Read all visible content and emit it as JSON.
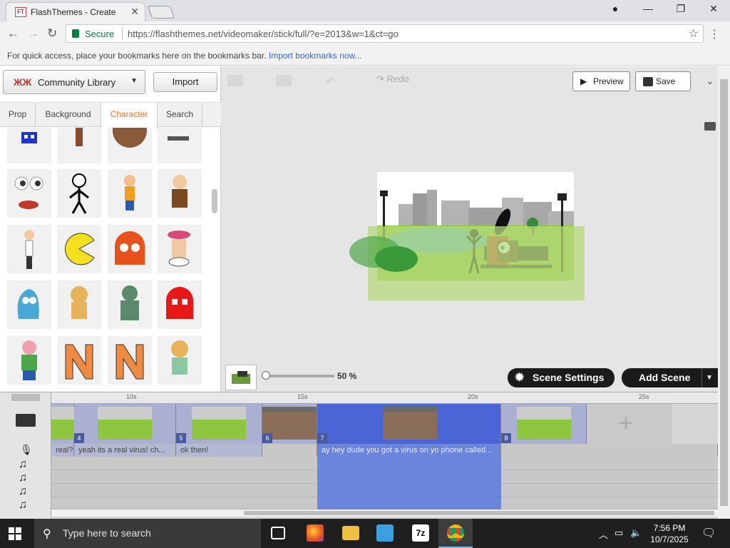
{
  "browser": {
    "tab_title": "FlashThemes - Create",
    "favicon_text": "FT",
    "secure_label": "Secure",
    "url": "https://flashthemes.net/videomaker/stick/full/?e=2013&w=1&ct=go",
    "bookmarks_message": "For quick access, place your bookmarks here on the bookmarks bar.",
    "bookmarks_link": "Import bookmarks now..."
  },
  "library": {
    "selector_label": "Community Library",
    "import_label": "Import",
    "tabs": [
      "Prop",
      "Background",
      "Character",
      "Search"
    ],
    "active_tab": "Character"
  },
  "toolbar": {
    "redo_label": "Redo",
    "preview_label": "Preview",
    "save_label": "Save"
  },
  "stage_controls": {
    "zoom_level": "50 %",
    "zoom_fraction": 0.0,
    "scene_settings_label": "Scene Settings",
    "add_scene_label": "Add Scene"
  },
  "timeline": {
    "ruler_labels": [
      "10s",
      "15s",
      "20s",
      "25s"
    ],
    "scenes": [
      {
        "number": "",
        "dialogue": "real?"
      },
      {
        "number": "4",
        "dialogue": "yeah its a real virus! ch..."
      },
      {
        "number": "5",
        "dialogue": "ok then!"
      },
      {
        "number": "6",
        "dialogue": ""
      },
      {
        "number": "7",
        "dialogue": "ay hey dude you got a virus on yo phone called..."
      },
      {
        "number": "8",
        "dialogue": ""
      }
    ]
  },
  "taskbar": {
    "search_placeholder": "Type here to search",
    "time": "7:56 PM",
    "date": "10/7/2025",
    "app_7z_label": "7z"
  },
  "colors": {
    "accent_tab": "#e8762c",
    "secure_green": "#0b8043",
    "selected_scene": "#4a66d6"
  }
}
